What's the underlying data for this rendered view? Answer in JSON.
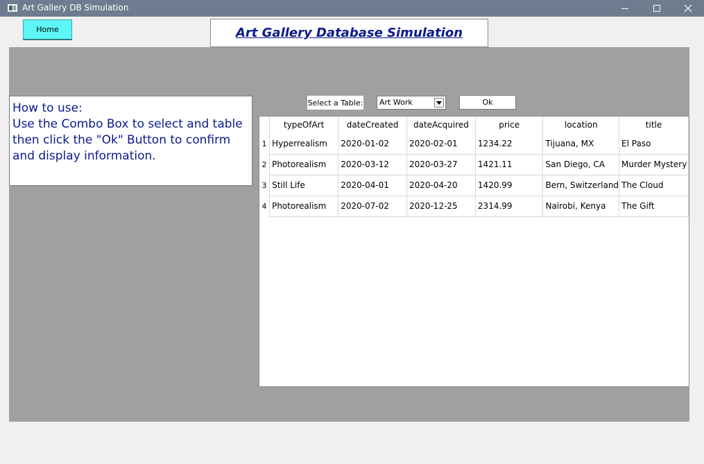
{
  "window": {
    "title": "Art Gallery DB Simulation"
  },
  "nav": {
    "home_label": "Home"
  },
  "header": {
    "title": "Art Gallery Database Simulation"
  },
  "instructions": {
    "heading": "How to use:",
    "body": "Use the Combo Box to select and table then click the \"Ok\" Button to confirm and display information."
  },
  "controls": {
    "select_label": "Select a Table:",
    "combo_value": "Art Work",
    "ok_label": "Ok"
  },
  "table": {
    "columns": [
      "typeOfArt",
      "dateCreated",
      "dateAcquired",
      "price",
      "location",
      "title"
    ],
    "rows": [
      {
        "index": "1",
        "cells": [
          "Hyperrealism",
          "2020-01-02",
          "2020-02-01",
          "1234.22",
          "Tijuana, MX",
          "El Paso"
        ]
      },
      {
        "index": "2",
        "cells": [
          "Photorealism",
          "2020-03-12",
          "2020-03-27",
          "1421.11",
          "San Diego, CA",
          "Murder Mystery"
        ]
      },
      {
        "index": "3",
        "cells": [
          "Still Life",
          "2020-04-01",
          "2020-04-20",
          "1420.99",
          "Bern, Switzerland",
          "The Cloud"
        ]
      },
      {
        "index": "4",
        "cells": [
          "Photorealism",
          "2020-07-02",
          "2020-12-25",
          "2314.99",
          "Nairobi, Kenya",
          "The Gift"
        ]
      }
    ]
  }
}
